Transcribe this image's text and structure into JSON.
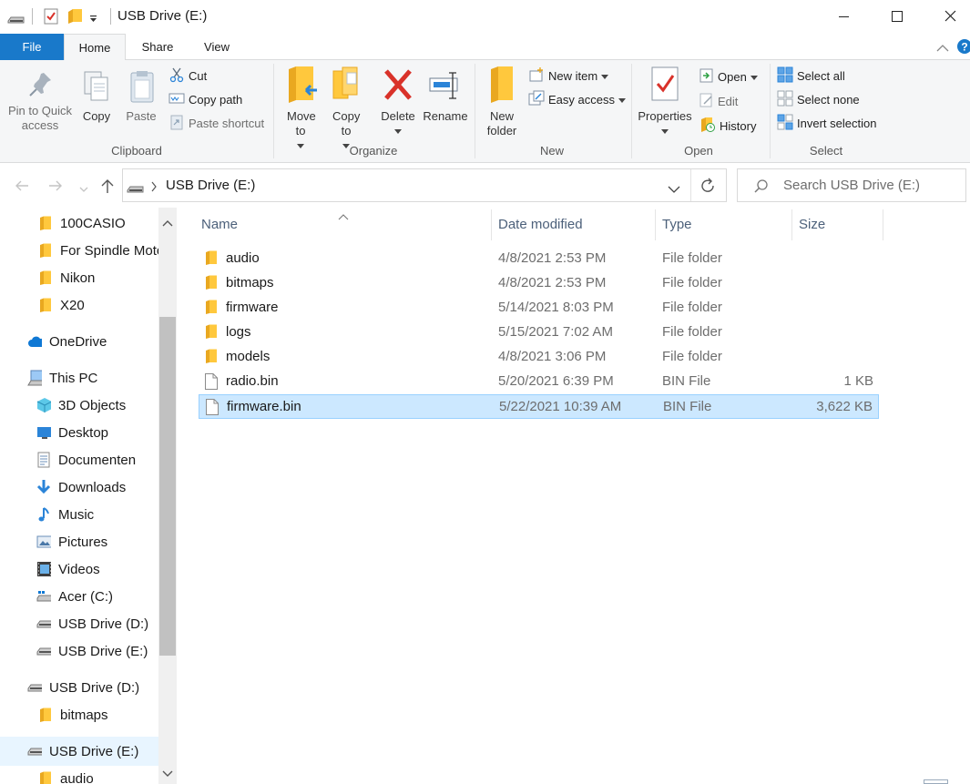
{
  "window": {
    "title": "USB Drive (E:)"
  },
  "menu": {
    "tabs": [
      {
        "label": "File"
      },
      {
        "label": "Home"
      },
      {
        "label": "Share"
      },
      {
        "label": "View"
      }
    ]
  },
  "ribbon": {
    "clipboard": {
      "pin_label": "Pin to Quick access",
      "copy_label": "Copy",
      "paste_label": "Paste",
      "cut_label": "Cut",
      "copy_path_label": "Copy path",
      "paste_shortcut_label": "Paste shortcut",
      "group_label": "Clipboard"
    },
    "organize": {
      "move_to_label": "Move to",
      "copy_to_label": "Copy to",
      "delete_label": "Delete",
      "rename_label": "Rename",
      "group_label": "Organize"
    },
    "new": {
      "new_folder_label": "New folder",
      "new_item_label": "New item",
      "easy_access_label": "Easy access",
      "group_label": "New"
    },
    "open": {
      "properties_label": "Properties",
      "open_label": "Open",
      "edit_label": "Edit",
      "history_label": "History",
      "group_label": "Open"
    },
    "select": {
      "select_all_label": "Select all",
      "select_none_label": "Select none",
      "invert_label": "Invert selection",
      "group_label": "Select"
    }
  },
  "address": {
    "crumb": "USB Drive (E:)",
    "search_placeholder": "Search USB Drive (E:)"
  },
  "nav": {
    "items": [
      {
        "label": "100CASIO",
        "icon": "folder-icon"
      },
      {
        "label": "For Spindle Motor",
        "icon": "folder-icon"
      },
      {
        "label": "Nikon",
        "icon": "folder-icon"
      },
      {
        "label": "X20",
        "icon": "folder-icon"
      },
      {
        "label": "OneDrive",
        "icon": "cloud-icon"
      },
      {
        "label": "This PC",
        "icon": "computer-icon"
      },
      {
        "label": "3D Objects",
        "icon": "cube-icon"
      },
      {
        "label": "Desktop",
        "icon": "desktop-icon"
      },
      {
        "label": "Documenten",
        "icon": "document-icon"
      },
      {
        "label": "Downloads",
        "icon": "download-icon"
      },
      {
        "label": "Music",
        "icon": "music-icon"
      },
      {
        "label": "Pictures",
        "icon": "picture-icon"
      },
      {
        "label": "Videos",
        "icon": "video-icon"
      },
      {
        "label": "Acer (C:)",
        "icon": "windows-drive-icon"
      },
      {
        "label": "USB Drive (D:)",
        "icon": "usb-drive-icon"
      },
      {
        "label": "USB Drive (E:)",
        "icon": "usb-drive-icon"
      },
      {
        "label": "USB Drive (D:)",
        "icon": "usb-drive-icon"
      },
      {
        "label": "bitmaps",
        "icon": "folder-icon"
      },
      {
        "label": "USB Drive (E:)",
        "icon": "usb-drive-icon"
      },
      {
        "label": "audio",
        "icon": "folder-icon"
      }
    ]
  },
  "columns": {
    "name": "Name",
    "date": "Date modified",
    "type": "Type",
    "size": "Size"
  },
  "files": [
    {
      "name": "audio",
      "date": "4/8/2021 2:53 PM",
      "type": "File folder",
      "size": "",
      "icon": "folder-icon"
    },
    {
      "name": "bitmaps",
      "date": "4/8/2021 2:53 PM",
      "type": "File folder",
      "size": "",
      "icon": "folder-icon"
    },
    {
      "name": "firmware",
      "date": "5/14/2021 8:03 PM",
      "type": "File folder",
      "size": "",
      "icon": "folder-icon"
    },
    {
      "name": "logs",
      "date": "5/15/2021 7:02 AM",
      "type": "File folder",
      "size": "",
      "icon": "folder-icon"
    },
    {
      "name": "models",
      "date": "4/8/2021 3:06 PM",
      "type": "File folder",
      "size": "",
      "icon": "folder-icon"
    },
    {
      "name": "radio.bin",
      "date": "5/20/2021 6:39 PM",
      "type": "BIN File",
      "size": "1 KB",
      "icon": "file-icon"
    },
    {
      "name": "firmware.bin",
      "date": "5/22/2021 10:39 AM",
      "type": "BIN File",
      "size": "3,622 KB",
      "icon": "file-icon",
      "selected": true
    }
  ],
  "colors": {
    "accent": "#1979ca",
    "selection": "#cce8ff",
    "folder": "#ffc83d"
  }
}
